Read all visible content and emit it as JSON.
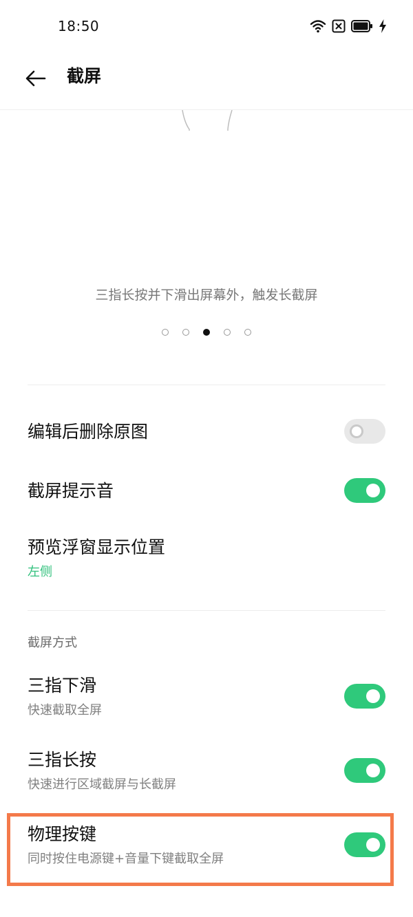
{
  "status_bar": {
    "time": "18:50",
    "icons": [
      "wifi-icon",
      "sim-blocked-icon",
      "battery-icon",
      "charging-bolt-icon"
    ]
  },
  "header": {
    "title": "截屏",
    "back_icon": "arrow-left-icon"
  },
  "illustration": {
    "caption": "三指长按并下滑出屏幕外，触发长截屏",
    "page_count": 5,
    "active_page": 3
  },
  "settings": {
    "delete_original": {
      "label": "编辑后删除原图",
      "on": false
    },
    "shutter_sound": {
      "label": "截屏提示音",
      "on": true
    },
    "preview_position": {
      "label": "预览浮窗显示位置",
      "value": "左侧"
    }
  },
  "methods": {
    "header": "截屏方式",
    "three_finger_swipe": {
      "label": "三指下滑",
      "desc": "快速截取全屏",
      "on": true
    },
    "three_finger_hold": {
      "label": "三指长按",
      "desc": "快速进行区域截屏与长截屏",
      "on": true
    },
    "physical_keys": {
      "label": "物理按键",
      "desc": "同时按住电源键+音量下键截取全屏",
      "on": true
    }
  },
  "colors": {
    "accent": "#2fc97b",
    "accent_text": "#2fc07b",
    "highlight": "#f47a4a"
  }
}
